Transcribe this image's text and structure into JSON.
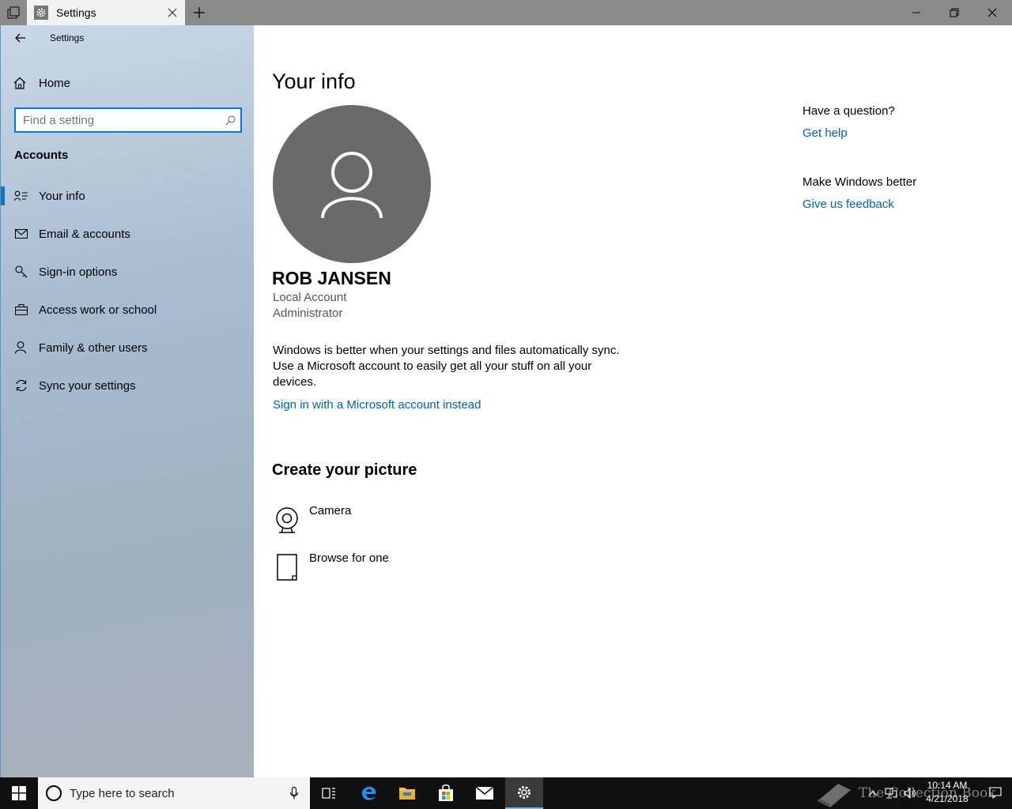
{
  "window": {
    "tab_title": "Settings",
    "app_title": "Settings"
  },
  "sidebar": {
    "home_label": "Home",
    "search_placeholder": "Find a setting",
    "section_title": "Accounts",
    "items": [
      {
        "label": "Your info",
        "icon": "contact-card-icon",
        "selected": true
      },
      {
        "label": "Email & accounts",
        "icon": "mail-icon",
        "selected": false
      },
      {
        "label": "Sign-in options",
        "icon": "key-icon",
        "selected": false
      },
      {
        "label": "Access work or school",
        "icon": "briefcase-icon",
        "selected": false
      },
      {
        "label": "Family & other users",
        "icon": "person-add-icon",
        "selected": false
      },
      {
        "label": "Sync your settings",
        "icon": "sync-icon",
        "selected": false
      }
    ]
  },
  "main": {
    "title": "Your info",
    "user_name": "ROB JANSEN",
    "account_type": "Local Account",
    "account_role": "Administrator",
    "sync_message": "Windows is better when your settings and files automatically sync. Use a Microsoft account to easily get all your stuff on all your devices.",
    "ms_account_link": "Sign in with a Microsoft account instead",
    "create_picture_title": "Create your picture",
    "picture_options": [
      {
        "label": "Camera",
        "icon": "camera-icon"
      },
      {
        "label": "Browse for one",
        "icon": "document-icon"
      }
    ]
  },
  "help": {
    "question": "Have a question?",
    "get_help": "Get help",
    "better": "Make Windows better",
    "feedback": "Give us feedback"
  },
  "taskbar": {
    "search_placeholder": "Type here to search",
    "time": "10:14 AM",
    "date": "4/21/2018",
    "watermark": "The Collection Book"
  },
  "colors": {
    "accent": "#0078d7",
    "link": "#0063b1",
    "avatar_bg": "#6a6a6a",
    "taskbar_bg": "#101010"
  }
}
